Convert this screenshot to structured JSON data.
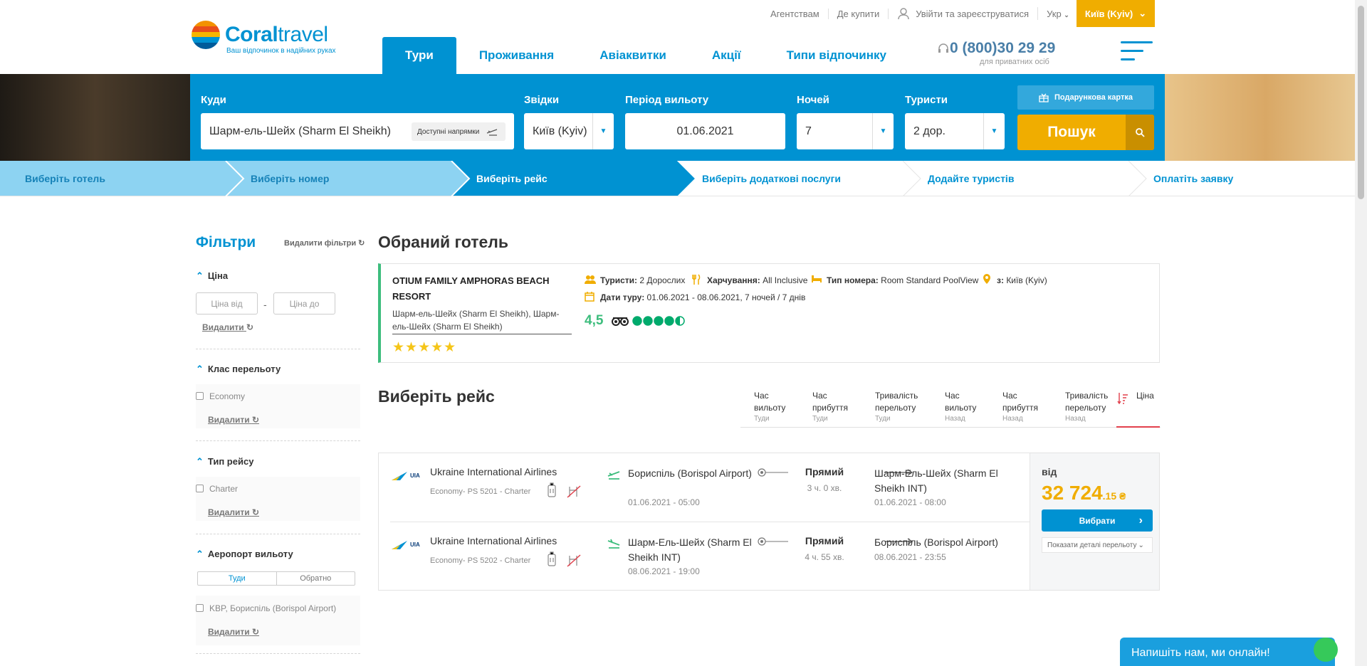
{
  "header": {
    "links": [
      "Агентствам",
      "Де купити",
      "Увійти та зареєструватися",
      "Укр"
    ],
    "city": "Київ (Kyiv)",
    "logo_name_1": "Coral",
    "logo_name_2": "travel",
    "logo_tagline": "Ваш відпочинок в надійних руках",
    "nav": [
      "Тури",
      "Проживання",
      "Авіаквитки",
      "Акції",
      "Типи відпочинку"
    ],
    "phone": "0 (800)30 29 29",
    "phone_sub": "для приватних осіб"
  },
  "search": {
    "to_label": "Куди",
    "to_value": "Шарм-ель-Шейх (Sharm El Sheikh)",
    "available_directions": "Доступні напрямки",
    "from_label": "Звідки",
    "from_value": "Київ (Kyiv)",
    "period_label": "Період вильоту",
    "period_value": "01.06.2021",
    "nights_label": "Ночей",
    "nights_value": "7",
    "tourists_label": "Туристи",
    "tourists_value": "2 дор.",
    "gift_card": "Подарункова картка",
    "search_button": "Пошук"
  },
  "steps": [
    "Виберіть готель",
    "Виберіть номер",
    "Виберіть рейс",
    "Виберіть додаткові послуги",
    "Додайте туристів",
    "Оплатіть заявку"
  ],
  "filters": {
    "title": "Фільтри",
    "clear_all": "Видалити фільтри",
    "price": "Ціна",
    "price_from": "Ціна від",
    "price_to": "Ціна до",
    "delete": "Видалити",
    "flight_class": "Клас перельоту",
    "economy": "Economy",
    "flight_type": "Тип рейсу",
    "charter": "Charter",
    "departure_airport": "Аеропорт вильоту",
    "tab_there": "Туди",
    "tab_back": "Обратно",
    "airport_option": "KBP, Бориспіль (Borispol Airport)"
  },
  "hotel": {
    "section_title": "Обраний готель",
    "name": "OTIUM FAMILY AMPHORAS BEACH RESORT",
    "location": "Шарм-ель-Шейх (Sharm El Sheikh), Шарм-ель-Шейх (Sharm El Sheikh)",
    "stars": 5,
    "tourists_label": "Туристи:",
    "tourists_value": "2 Дорослих",
    "meal_label": "Харчування:",
    "meal_value": "All Inclusive",
    "room_label": "Тип номера:",
    "room_value": "Room Standard PoolView",
    "from_label": "з:",
    "from_value": "Київ (Kyiv)",
    "dates_label": "Дати туру:",
    "dates_value": "01.06.2021 - 08.06.2021, 7 ночей / 7 днів",
    "rating": "4,5",
    "rating_value": 4.5
  },
  "flight_section": {
    "title": "Виберіть рейс",
    "sort_columns": [
      {
        "label": "Час вильоту",
        "sub": "Туди"
      },
      {
        "label": "Час прибуття",
        "sub": "Туди"
      },
      {
        "label": "Тривалість перельоту",
        "sub": "Туди"
      },
      {
        "label": "Час вильоту",
        "sub": "Назад"
      },
      {
        "label": "Час прибуття",
        "sub": "Назад"
      },
      {
        "label": "Тривалість перельоту",
        "sub": "Назад"
      },
      {
        "label": "Ціна",
        "sub": ""
      }
    ]
  },
  "flights": [
    {
      "airline_code": "UIA",
      "airline": "Ukraine International Airlines",
      "details": "Economy- PS 5201 - Charter",
      "from": "Бориспіль (Borispol Airport)",
      "depart": "01.06.2021 - 05:00",
      "type": "Прямий",
      "duration": "3 ч. 0 хв.",
      "to": "Шарм-Ель-Шейх (Sharm El Sheikh INT)",
      "arrive": "01.06.2021 - 08:00"
    },
    {
      "airline_code": "UIA",
      "airline": "Ukraine International Airlines",
      "details": "Economy- PS 5202 - Charter",
      "from": "Шарм-Ель-Шейх (Sharm El Sheikh INT)",
      "depart": "08.06.2021 - 19:00",
      "type": "Прямий",
      "duration": "4 ч. 55 хв.",
      "to": "Бориспіль (Borispol Airport)",
      "arrive": "08.06.2021 - 23:55"
    }
  ],
  "price": {
    "from": "від",
    "main": "32 724",
    "cents": ".15 ₴",
    "select_button": "Вибрати",
    "details_link": "Показати деталі перельоту"
  },
  "chat": "Напишіть нам, ми онлайн!",
  "colors": {
    "primary": "#0092d2",
    "accent": "#f0ad00",
    "green": "#3dbd7d"
  }
}
